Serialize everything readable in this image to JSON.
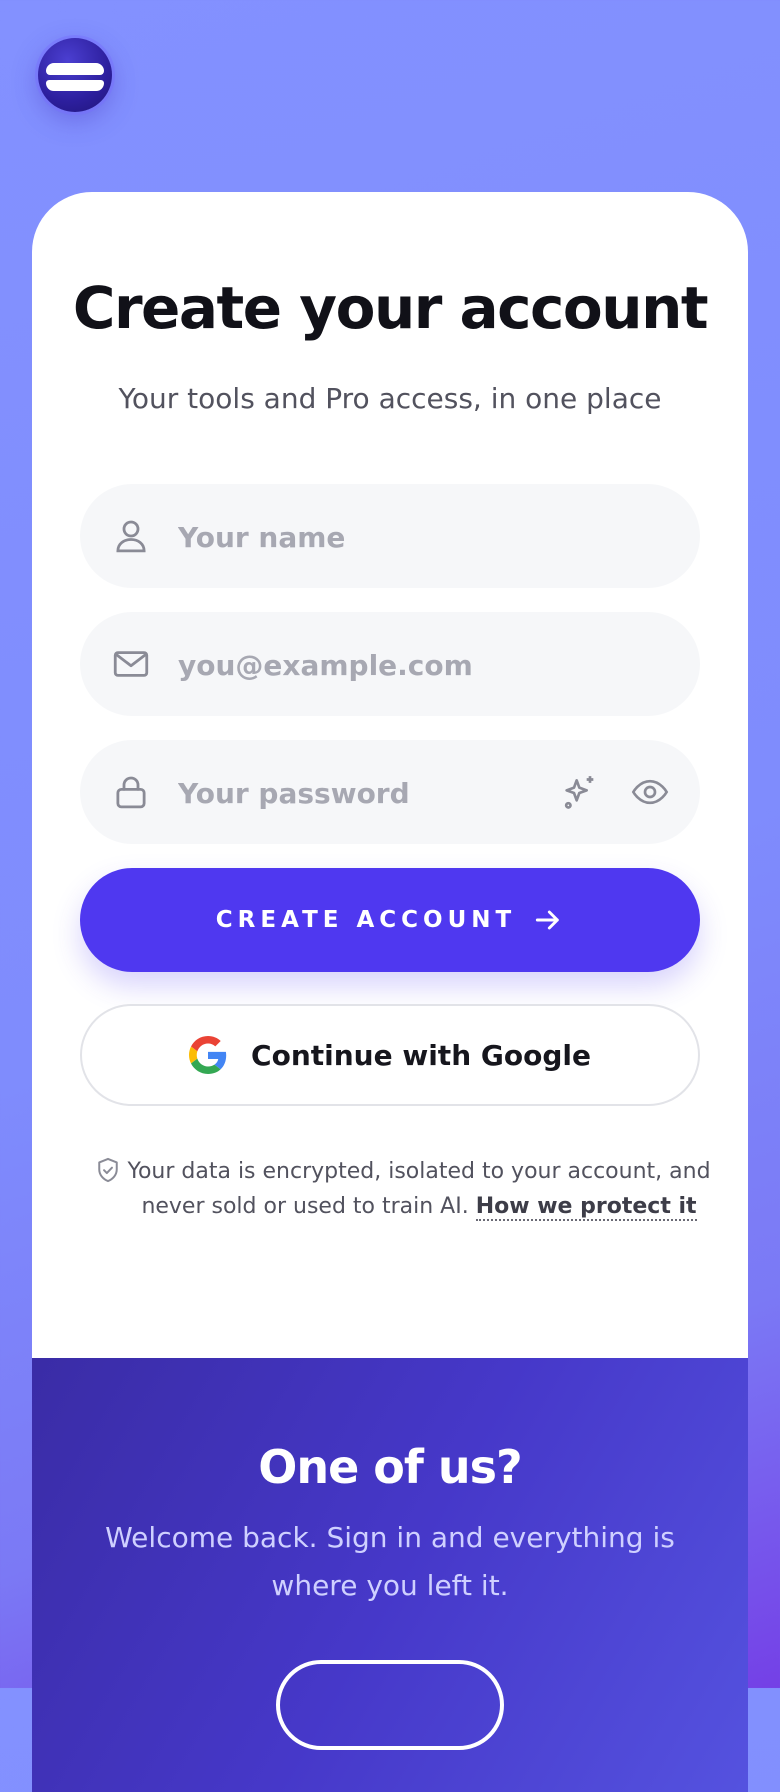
{
  "header": {
    "logo_icon": "brand-logo-icon"
  },
  "signup": {
    "title": "Create your account",
    "subtitle": "Your tools and Pro access, in one place",
    "name_field": {
      "placeholder": "Your name",
      "value": "",
      "icon": "user-icon"
    },
    "email_field": {
      "placeholder": "you@example.com",
      "value": "",
      "icon": "mail-icon"
    },
    "password_field": {
      "placeholder": "Your password",
      "value": "",
      "icon": "lock-icon",
      "generate_icon": "sparkle-icon",
      "toggle_icon": "eye-icon"
    },
    "create_button": {
      "label": "CREATE ACCOUNT",
      "icon": "arrow-right-icon"
    },
    "google_button": {
      "label": "Continue with Google",
      "icon": "google-icon"
    },
    "privacy": {
      "text": "Your data is encrypted, isolated to your account, and never sold or used to train AI.",
      "link": "How we protect it",
      "icon": "shield-check-icon"
    }
  },
  "signin": {
    "title": "One of us?",
    "text": "Welcome back. Sign in and everything is where you left it."
  },
  "colors": {
    "background_top": "#8391ff",
    "background_bottom": "#7440e6",
    "primary": "#4f38f0",
    "signin_panel": "#4638c9",
    "title_text": "#111118"
  }
}
